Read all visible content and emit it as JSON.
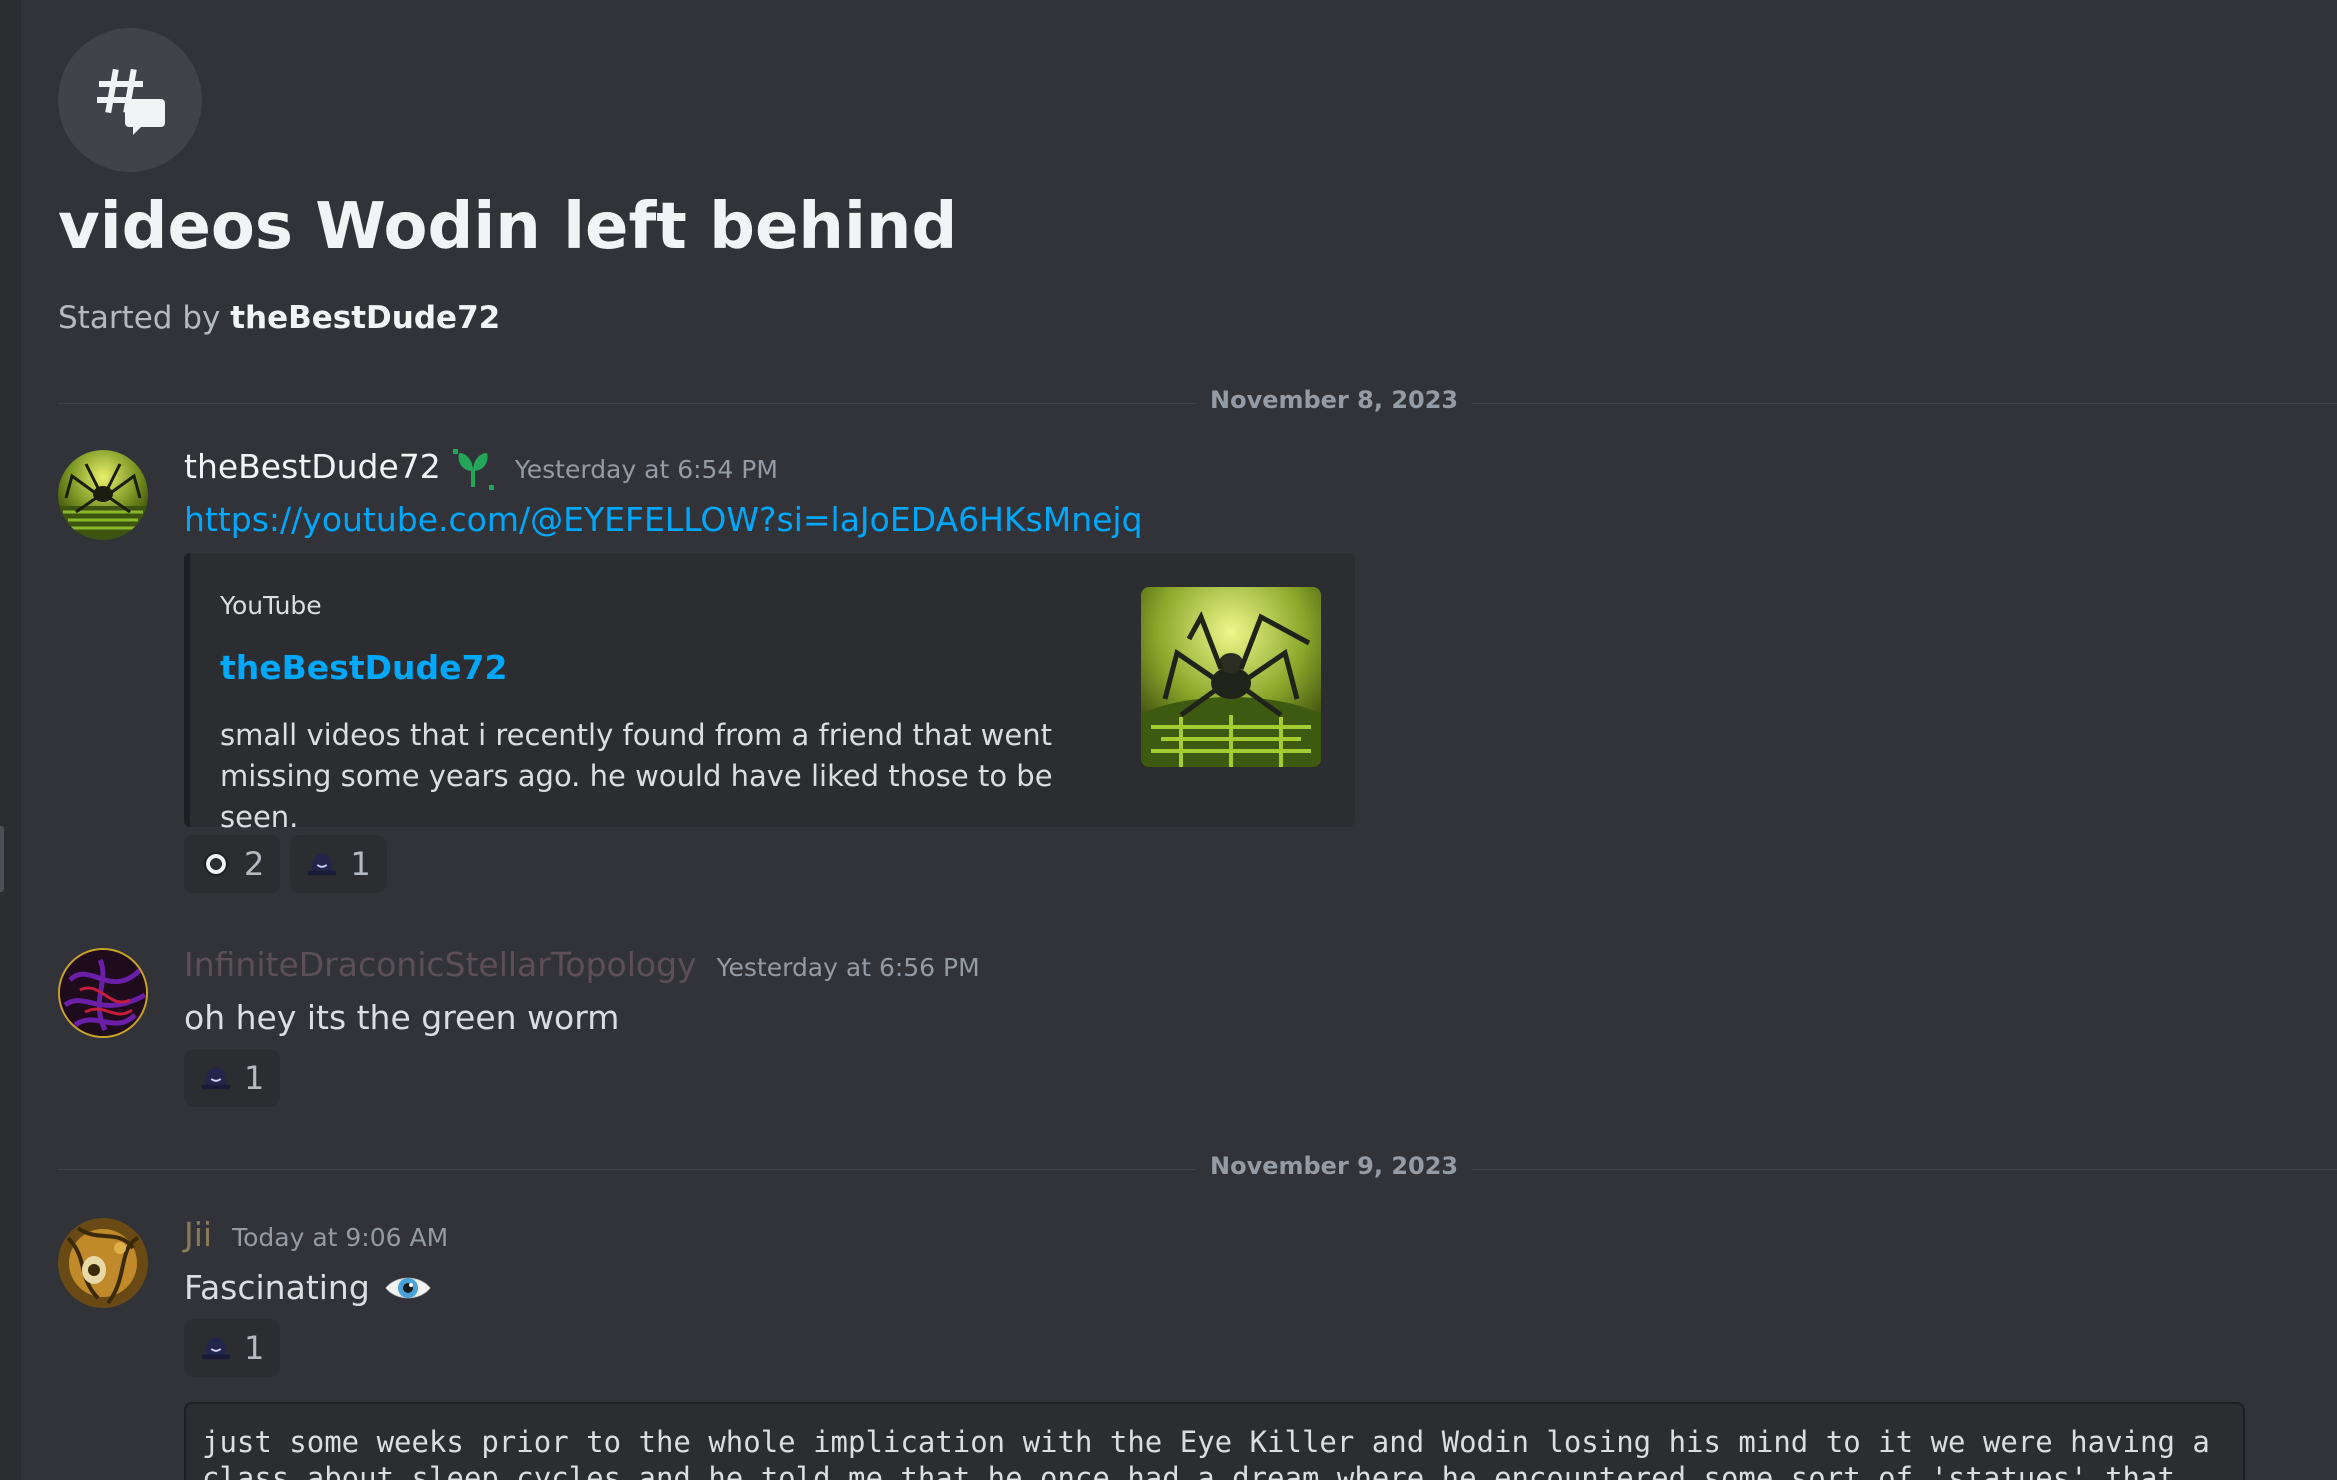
{
  "thread": {
    "title": "videos Wodin left behind",
    "started_by_prefix": "Started by",
    "started_by_user": "theBestDude72"
  },
  "dividers": [
    "November 8, 2023",
    "November 9, 2023"
  ],
  "messages": [
    {
      "username": "theBestDude72",
      "username_color": "#f2f3f5",
      "timestamp": "Yesterday at 6:54 PM",
      "link": "https://youtube.com/@EYEFELLOW?si=laJoEDA6HKsMnejq",
      "embed": {
        "provider": "YouTube",
        "title": "theBestDude72",
        "description": "small videos that i recently found from a friend that went missing some years ago. he would have liked those to be seen."
      },
      "reactions": [
        {
          "icon": "ring-emoji-icon",
          "count": "2"
        },
        {
          "icon": "hat-emoji-icon",
          "count": "1"
        }
      ]
    },
    {
      "username": "InfiniteDraconicStellarTopology",
      "username_color": "#5c4f55",
      "timestamp": "Yesterday at 6:56 PM",
      "text": "oh hey its the green worm",
      "reactions": [
        {
          "icon": "hat-emoji-icon",
          "count": "1"
        }
      ]
    },
    {
      "username": "Jii",
      "username_color": "#8a7a5a",
      "timestamp": "Today at 9:06 AM",
      "text": "Fascinating",
      "text_emoji": "eye-emoji-icon",
      "reactions": [
        {
          "icon": "hat-emoji-icon",
          "count": "1"
        }
      ]
    }
  ],
  "code_block": {
    "line1": "just some weeks prior to the whole implication with the Eye Killer and Wodin losing his mind to it we were having a",
    "line2": "class about sleep cycles and he told me that he once had a dream where he encountered some sort of 'statues' that"
  },
  "colors": {
    "background": "#313338",
    "link": "#00a8fc",
    "nitro_badge": "#23a55a"
  }
}
